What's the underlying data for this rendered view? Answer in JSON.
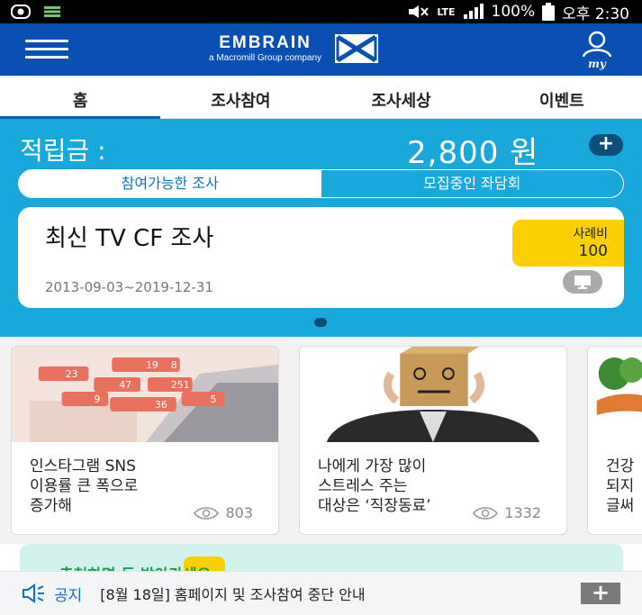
{
  "status_bar": {
    "network": "LTE",
    "battery": "100%",
    "time": "오후 2:30"
  },
  "header": {
    "logo_main": "EMBRAIN",
    "logo_sub": "a Macromill Group company",
    "my_label": "my"
  },
  "tabs": [
    {
      "label": "홈",
      "active": true
    },
    {
      "label": "조사참여",
      "active": false
    },
    {
      "label": "조사세상",
      "active": false
    },
    {
      "label": "이벤트",
      "active": false
    }
  ],
  "points": {
    "label": "적립금 :",
    "value": "2,800 원",
    "add": "+"
  },
  "segment": {
    "left": "참여가능한 조사",
    "right": "모집중인 좌담회"
  },
  "survey_card": {
    "title": "최신 TV CF 조사",
    "date_range": "2013-09-03~2019-12-31",
    "reward_label": "사례비",
    "reward_value": "100"
  },
  "articles": [
    {
      "title_line1": "인스타그램 SNS",
      "title_line2": "이용률 큰 폭으로",
      "title_line3": "증가해",
      "views": "803",
      "bubbles": [
        "23",
        "19",
        "8",
        "47",
        "251",
        "9",
        "36",
        "5"
      ]
    },
    {
      "title_line1": "나에게 가장 많이",
      "title_line2": "스트레스 주는",
      "title_line3": "대상은 ‘직장동료’",
      "views": "1332"
    },
    {
      "title_line1": "건강",
      "title_line2": "되지",
      "title_line3": "글써"
    }
  ],
  "banner": {
    "text": "추천하면 돈 받아가세요"
  },
  "notice": {
    "label": "공지",
    "text": "[8월 18일] 홈페이지 및 조사참여 중단 안내",
    "plus": "+"
  },
  "colors": {
    "header_blue": "#0a4fb4",
    "points_bg": "#18a8dc",
    "reward_yellow": "#fcd000",
    "notice_blue": "#1170c8"
  }
}
